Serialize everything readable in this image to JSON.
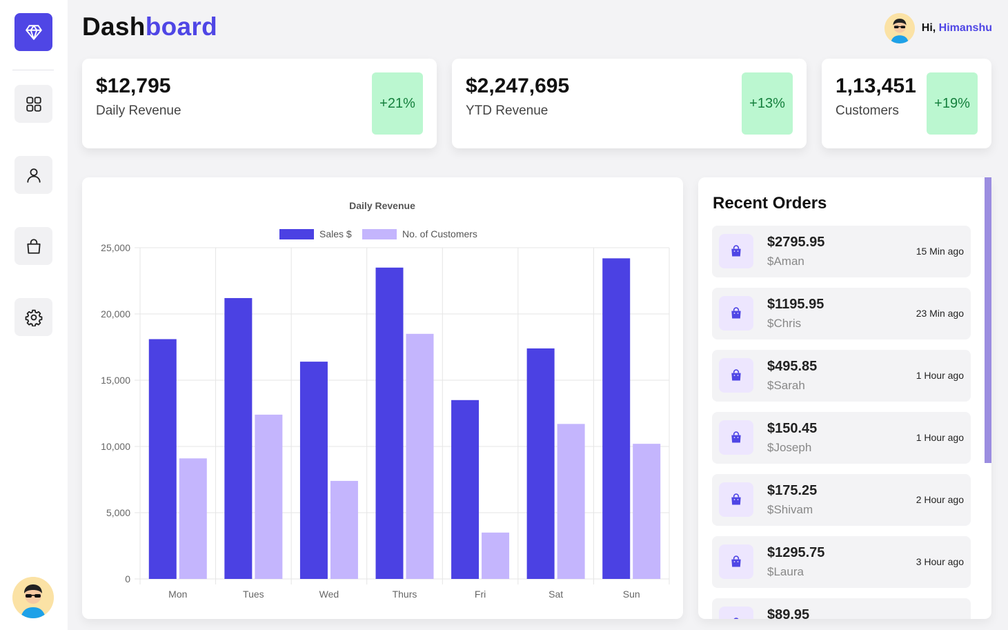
{
  "header": {
    "title_part1": "Dash",
    "title_part2": "board",
    "greeting_prefix": "Hi, ",
    "user_name": "Himanshu"
  },
  "colors": {
    "accent": "#4f46e5",
    "sales_bar": "#4b41e3",
    "customers_bar": "#c4b5fd",
    "badge_bg": "#bbf7d0",
    "badge_text": "#15803d"
  },
  "sidebar": {
    "logo_icon": "diamond-icon",
    "items": [
      {
        "icon": "dashboard-grid-icon"
      },
      {
        "icon": "user-icon"
      },
      {
        "icon": "shopping-bag-icon"
      },
      {
        "icon": "settings-gear-icon"
      }
    ]
  },
  "stats": [
    {
      "value": "$12,795",
      "label": "Daily Revenue",
      "change": "+21%"
    },
    {
      "value": "$2,247,695",
      "label": "YTD Revenue",
      "change": "+13%"
    },
    {
      "value": "1,13,451",
      "label": "Customers",
      "change": "+19%"
    }
  ],
  "chart_data": {
    "type": "bar",
    "title": "Daily Revenue",
    "categories": [
      "Mon",
      "Tues",
      "Wed",
      "Thurs",
      "Fri",
      "Sat",
      "Sun"
    ],
    "series": [
      {
        "name": "Sales $",
        "values": [
          18100,
          21200,
          16400,
          23500,
          13500,
          17400,
          24200
        ]
      },
      {
        "name": "No. of Customers",
        "values": [
          9100,
          12400,
          7400,
          18500,
          3500,
          11700,
          10200
        ]
      }
    ],
    "ylim": [
      0,
      25000
    ],
    "yticks": [
      0,
      5000,
      10000,
      15000,
      20000,
      25000
    ],
    "ytick_labels": [
      "0",
      "5,000",
      "10,000",
      "15,000",
      "20,000",
      "25,000"
    ],
    "grid": true,
    "legend": "top-center"
  },
  "orders": {
    "title": "Recent Orders",
    "items": [
      {
        "amount": "$2795.95",
        "name": "$Aman",
        "time": "15 Min ago"
      },
      {
        "amount": "$1195.95",
        "name": "$Chris",
        "time": "23 Min ago"
      },
      {
        "amount": "$495.85",
        "name": "$Sarah",
        "time": "1 Hour ago"
      },
      {
        "amount": "$150.45",
        "name": "$Joseph",
        "time": "1 Hour ago"
      },
      {
        "amount": "$175.25",
        "name": "$Shivam",
        "time": "2 Hour ago"
      },
      {
        "amount": "$1295.75",
        "name": "$Laura",
        "time": "3 Hour ago"
      },
      {
        "amount": "$89.95",
        "name": "",
        "time": ""
      }
    ]
  }
}
